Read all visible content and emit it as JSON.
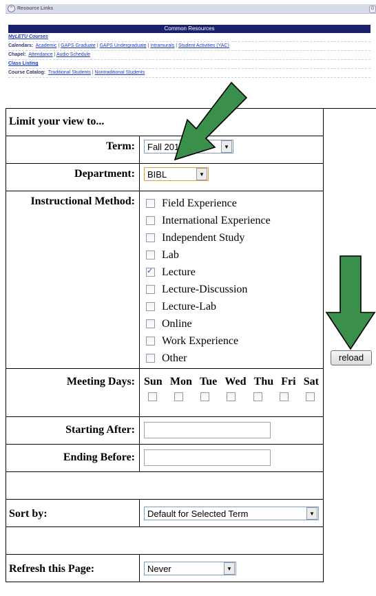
{
  "resource_links": {
    "header": "Resource Links",
    "bar_title": "Common Resources",
    "myletu": "MyLETU Courses",
    "calendars_label": "Calendars:",
    "calendars": [
      "Academic",
      "GAPS Graduate",
      "GAPS Undergraduate",
      "Intramurals",
      "Student Activities (YAC)"
    ],
    "chapel_label": "Chapel:",
    "chapel": [
      "Attendance",
      "Audio Schedule"
    ],
    "class_listing": "Class Listing",
    "catalog_label": "Course Catalog:",
    "catalog": [
      "Traditional Students",
      "Nontraditional Students"
    ]
  },
  "form": {
    "title": "Limit your view to...",
    "term_label": "Term:",
    "term_value": "Fall 2012",
    "department_label": "Department:",
    "department_value": "BIBL",
    "method_label": "Instructional Method:",
    "methods": [
      {
        "label": "Field Experience",
        "checked": false
      },
      {
        "label": "International Experience",
        "checked": false
      },
      {
        "label": "Independent Study",
        "checked": false
      },
      {
        "label": "Lab",
        "checked": false
      },
      {
        "label": "Lecture",
        "checked": true
      },
      {
        "label": "Lecture-Discussion",
        "checked": false
      },
      {
        "label": "Lecture-Lab",
        "checked": false
      },
      {
        "label": "Online",
        "checked": false
      },
      {
        "label": "Work Experience",
        "checked": false
      },
      {
        "label": "Other",
        "checked": false
      }
    ],
    "meeting_days_label": "Meeting Days:",
    "days": [
      "Sun",
      "Mon",
      "Tue",
      "Wed",
      "Thu",
      "Fri",
      "Sat"
    ],
    "starting_after_label": "Starting After:",
    "starting_after_value": "",
    "ending_before_label": "Ending Before:",
    "ending_before_value": "",
    "sort_label": "Sort by:",
    "sort_value": "Default for Selected Term",
    "refresh_label": "Refresh this Page:",
    "refresh_value": "Never",
    "reload_label": "reload"
  },
  "colors": {
    "arrow": "#3a8f4b",
    "resource_bar": "#1a1f6b",
    "link": "#1c3cc4"
  }
}
